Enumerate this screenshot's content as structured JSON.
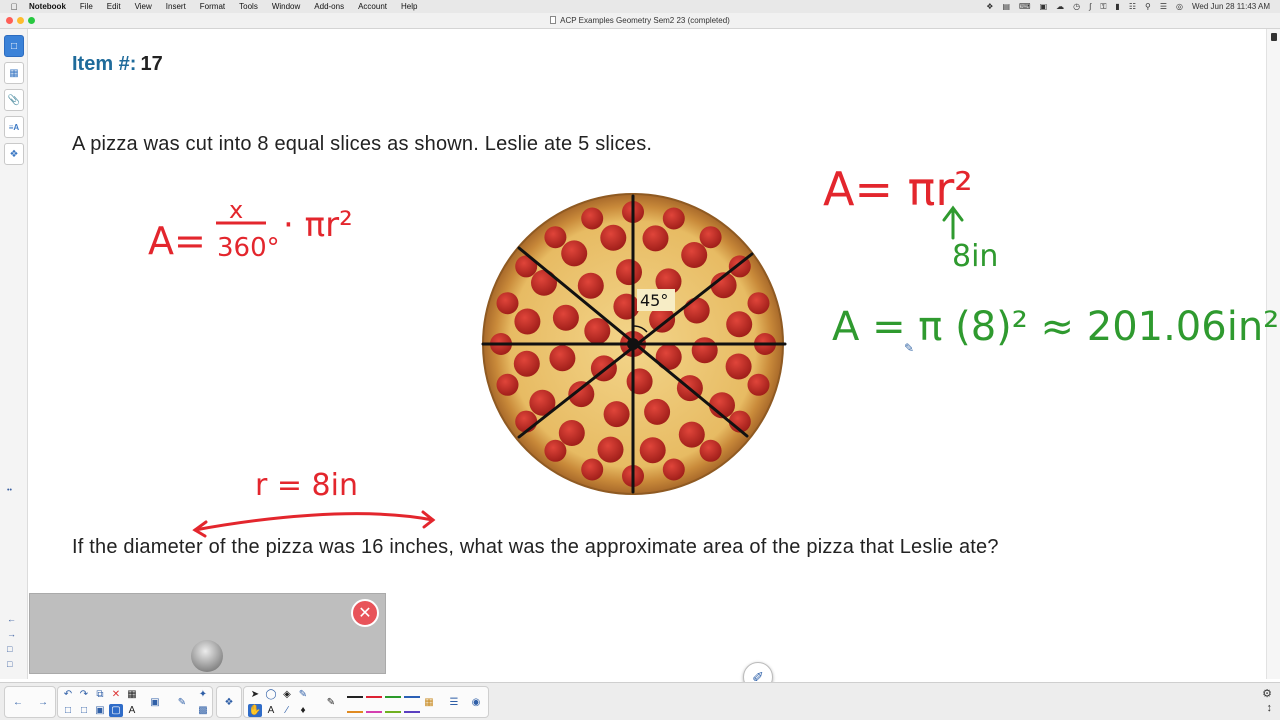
{
  "menubar": {
    "app_name": "Notebook",
    "items": [
      "File",
      "Edit",
      "View",
      "Insert",
      "Format",
      "Tools",
      "Window",
      "Add-ons",
      "Account",
      "Help"
    ],
    "clock": "Wed Jun 28  11:43 AM"
  },
  "window": {
    "title": "ACP Examples Geometry Sem2 23 (completed)"
  },
  "page": {
    "item_label": "Item #:",
    "item_number": "17",
    "question_intro": "A pizza was cut into 8 equal slices as shown. Leslie ate 5 slices.",
    "question_main": "If the diameter of the pizza was 16 inches, what was the approximate area of the pizza that Leslie ate?",
    "angle_label": "45°"
  },
  "annotations": {
    "sector_formula_lhs": "A=",
    "sector_numerator": "x",
    "sector_denominator": "360°",
    "sector_rhs": "· πr²",
    "radius_note": "r = 8in",
    "area_formula": "A= πr²",
    "radius_value": "8in",
    "area_calc": "A = π (8)² ≈ 201.06in²"
  },
  "colors": {
    "label_blue": "#1f6b9b",
    "ink_red": "#e3262d",
    "ink_green": "#2f9a2f",
    "close_red": "#e8545a",
    "tab_active": "#3b82d8"
  }
}
